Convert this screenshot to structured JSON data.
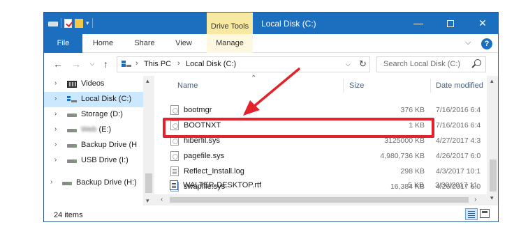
{
  "window": {
    "title": "Local Disk (C:)",
    "context_tab": "Drive Tools",
    "minimize_glyph": "—",
    "maximize_glyph": "",
    "close_glyph": "✕"
  },
  "ribbon": {
    "tabs": [
      "File",
      "Home",
      "Share",
      "View",
      "Manage"
    ],
    "collapse_glyph": "⌵",
    "help_glyph": "?"
  },
  "address": {
    "crumbs": [
      "This PC",
      "Local Disk (C:)"
    ],
    "crumb_sep": "›",
    "search_placeholder": "Search Local Disk (C:)"
  },
  "nav_pane": {
    "items": [
      {
        "label": "Videos",
        "icon": "video-folder-icon"
      },
      {
        "label": "Local Disk (C:)",
        "icon": "windows-drive-icon",
        "selected": true
      },
      {
        "label": "Storage (D:)",
        "icon": "drive-icon"
      },
      {
        "label": "(E:)",
        "icon": "drive-icon",
        "blurred_prefix": "Web"
      },
      {
        "label": "Backup Drive (H",
        "icon": "drive-icon"
      },
      {
        "label": "USB Drive (I:)",
        "icon": "drive-icon"
      },
      {
        "label": "Backup Drive (H:)",
        "icon": "drive-icon"
      }
    ]
  },
  "columns": {
    "name": "Name",
    "size": "Size",
    "date": "Date modified"
  },
  "files": [
    {
      "name": "bootmgr",
      "size": "376 KB",
      "date": "7/16/2016 6:4",
      "icon": "system-file-icon"
    },
    {
      "name": "BOOTNXT",
      "size": "1 KB",
      "date": "7/16/2016 6:4",
      "icon": "system-file-icon"
    },
    {
      "name": "hiberfil.sys",
      "size": "3125000 KB",
      "date": "4/27/2017 4:3",
      "icon": "system-file-icon",
      "highlighted": true
    },
    {
      "name": "pagefile.sys",
      "size": "4,980,736 KB",
      "date": "4/26/2017 6:0",
      "icon": "system-file-icon"
    },
    {
      "name": "Reflect_Install.log",
      "size": "298 KB",
      "date": "4/3/2017 10:1",
      "icon": "log-file-icon"
    },
    {
      "name": "swapfile.sys",
      "size": "16,384 KB",
      "date": "4/26/2017 6:0",
      "icon": "system-file-icon"
    },
    {
      "name": "WALTER-DESKTOP.rtf",
      "size": "5 KB",
      "date": "3/30/2017 11:",
      "icon": "rtf-file-icon"
    }
  ],
  "status": {
    "item_count": "24 items"
  },
  "colors": {
    "accent": "#1c6fbf",
    "context_tab": "#f7e9a1",
    "highlight": "#e3222b",
    "selection": "#cce8ff"
  }
}
